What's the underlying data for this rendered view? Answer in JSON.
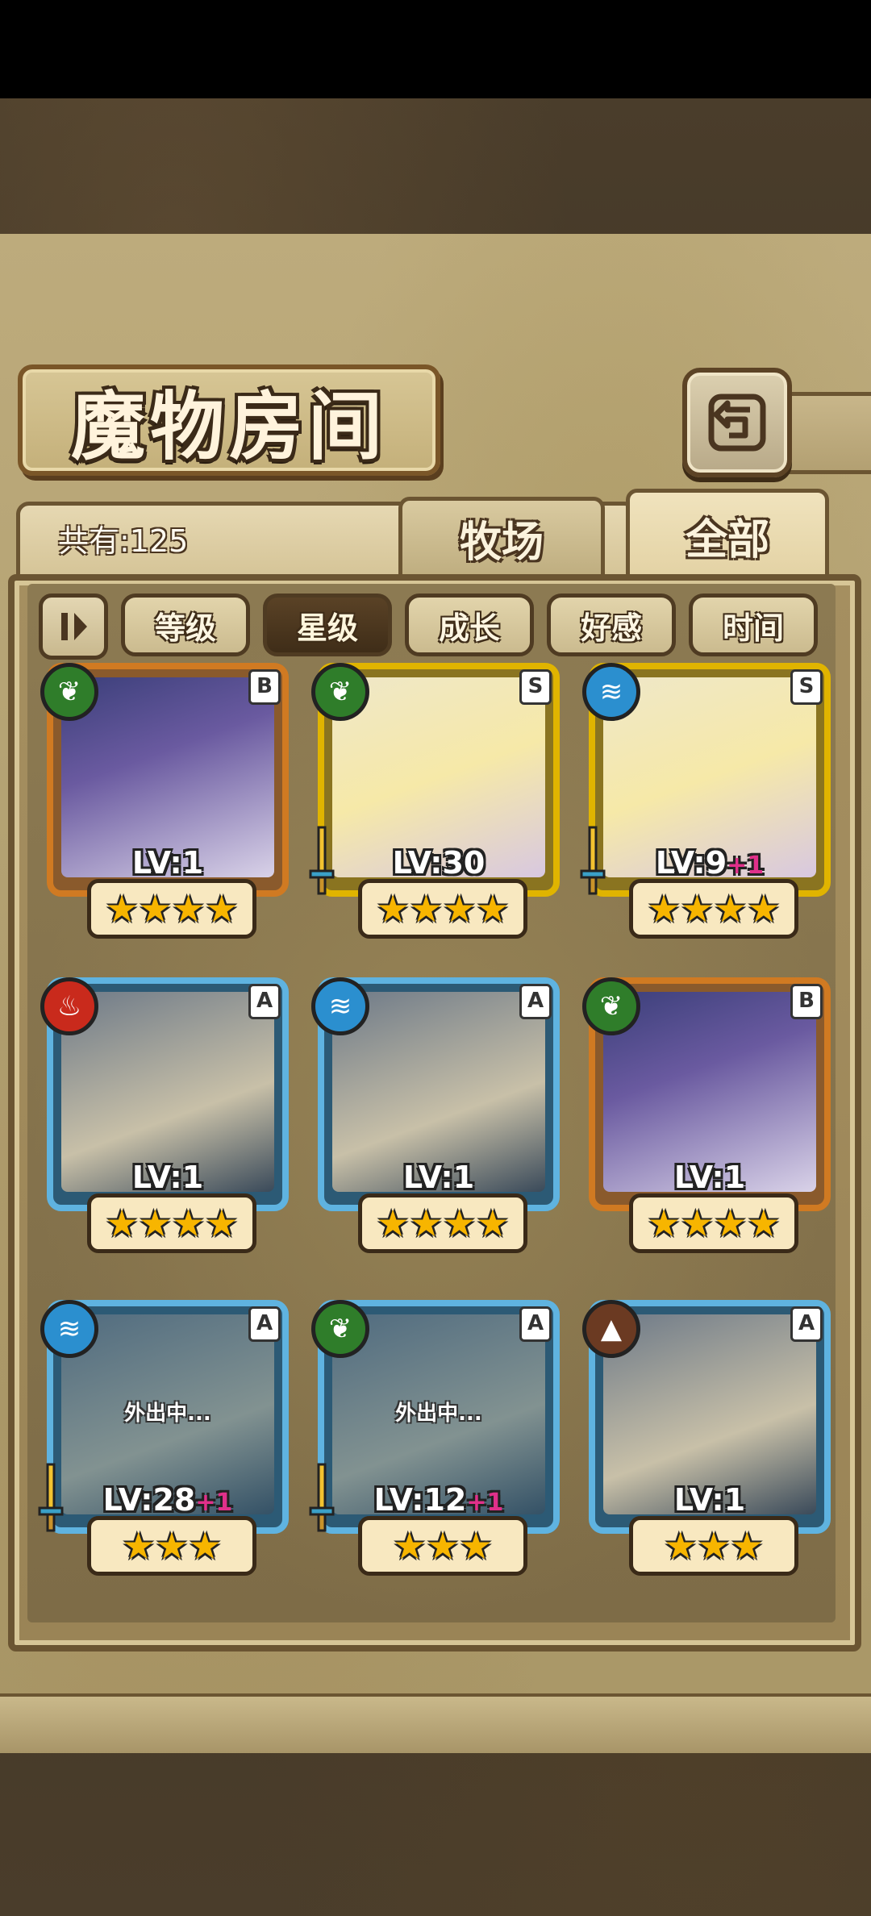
{
  "title": "魔物房间",
  "count_text": "共有:125",
  "tabs": [
    {
      "label": "牧场"
    },
    {
      "label": "全部"
    }
  ],
  "sort_buttons": [
    {
      "label": "等级"
    },
    {
      "label": "星级"
    },
    {
      "label": "成长"
    },
    {
      "label": "好感"
    },
    {
      "label": "时间"
    }
  ],
  "active_sort": "星级",
  "cards": [
    {
      "rank": "B",
      "element": "leaf-icon",
      "level": "LV:1",
      "plus": "",
      "stars": "★★★★",
      "away": "",
      "frame": "orange",
      "sword": false
    },
    {
      "rank": "S",
      "element": "leaf-icon",
      "level": "LV:30",
      "plus": "",
      "stars": "★★★★",
      "away": "",
      "frame": "gold",
      "sword": true
    },
    {
      "rank": "S",
      "element": "water-icon",
      "level": "LV:9",
      "plus": "+1",
      "stars": "★★★★",
      "away": "",
      "frame": "gold",
      "sword": true
    },
    {
      "rank": "A",
      "element": "fire-icon",
      "level": "LV:1",
      "plus": "",
      "stars": "★★★★",
      "away": "",
      "frame": "blue",
      "sword": false
    },
    {
      "rank": "A",
      "element": "water-icon",
      "level": "LV:1",
      "plus": "",
      "stars": "★★★★",
      "away": "",
      "frame": "blue",
      "sword": false
    },
    {
      "rank": "B",
      "element": "leaf-icon",
      "level": "LV:1",
      "plus": "",
      "stars": "★★★★",
      "away": "",
      "frame": "orange",
      "sword": false
    },
    {
      "rank": "A",
      "element": "water-icon",
      "level": "LV:28",
      "plus": "+1",
      "stars": "★★★",
      "away": "外出中...",
      "frame": "blue",
      "sword": true
    },
    {
      "rank": "A",
      "element": "leaf-icon",
      "level": "LV:12",
      "plus": "+1",
      "stars": "★★★",
      "away": "外出中...",
      "frame": "blue",
      "sword": true
    },
    {
      "rank": "A",
      "element": "earth-icon",
      "level": "LV:1",
      "plus": "",
      "stars": "★★★",
      "away": "",
      "frame": "blue",
      "sword": false
    }
  ],
  "colors": {
    "gold_frame": "#e0b400",
    "orange_frame": "#d07a22",
    "blue_frame": "#5fb3e0",
    "star": "#f7b500",
    "plus": "#e0308a"
  }
}
